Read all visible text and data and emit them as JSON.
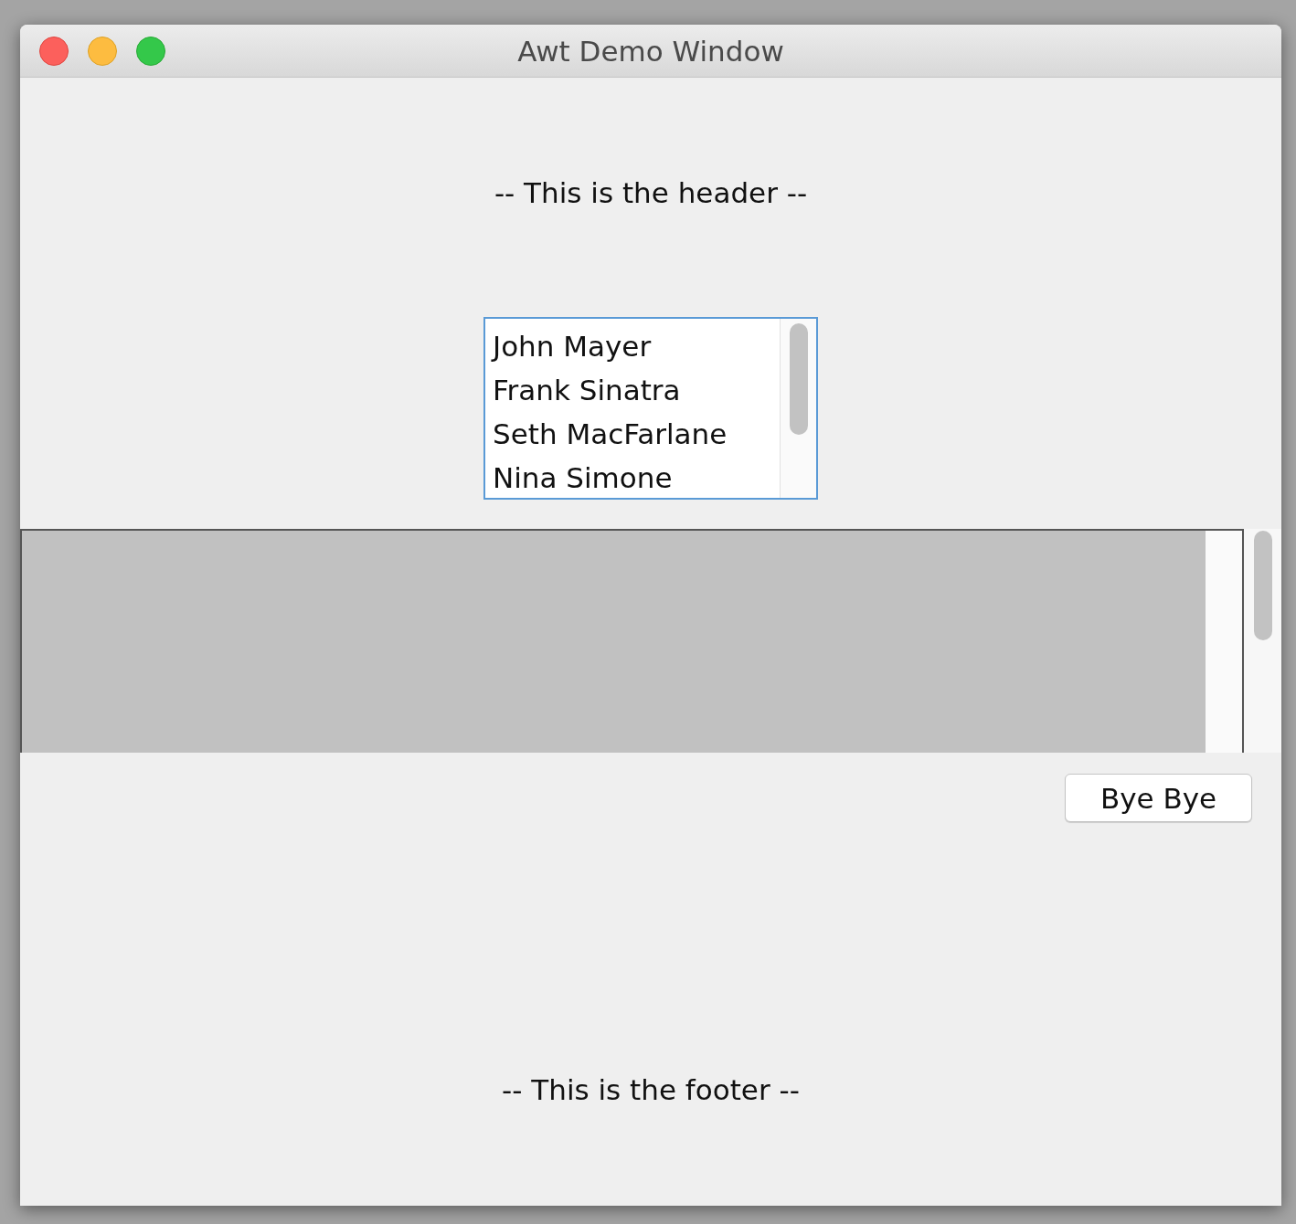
{
  "window": {
    "title": "Awt Demo Window"
  },
  "header": "-- This is the header --",
  "list": {
    "items": [
      {
        "label": "John Mayer",
        "selected": false
      },
      {
        "label": "Frank Sinatra",
        "selected": false
      },
      {
        "label": "Seth MacFarlane",
        "selected": false
      },
      {
        "label": "Nina Simone",
        "selected": false
      }
    ]
  },
  "button": "Bye Bye",
  "footer": "-- This is the footer --"
}
